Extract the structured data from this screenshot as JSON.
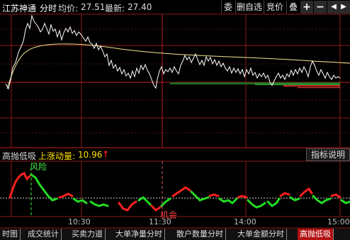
{
  "header": {
    "stock_name": "江苏神通",
    "mode": "分时",
    "avg_label": "均价:",
    "avg_value": "27.51",
    "last_label": "最新:",
    "last_value": "27.40"
  },
  "toolbar": {
    "btn_delegate": "委",
    "btn_remove_fav": "删自选",
    "btn_auction": "竞价",
    "btn_overlay": "叠",
    "btn_plus": "+",
    "btn_minus": "−",
    "btn_left": "◀",
    "btn_right": "▶"
  },
  "indicator": {
    "name": "高抛低吸",
    "momentum_label": "上涨动量:",
    "momentum_value": "10.96",
    "momentum_arrow": "↑",
    "help_button": "指标说明",
    "annotation_risk": "风险",
    "annotation_chance": "机会"
  },
  "xaxis": {
    "ticks": [
      "10:30",
      "11:30",
      "14:00",
      "15:00"
    ]
  },
  "tabs": [
    {
      "label": "时图",
      "active": false
    },
    {
      "label": "成交统计",
      "active": false
    },
    {
      "label": "买卖力道",
      "active": false
    },
    {
      "label": "大单净量分时",
      "active": false
    },
    {
      "label": "散户数量分时",
      "active": false
    },
    {
      "label": "大单金额分时",
      "active": false
    },
    {
      "label": "高抛低吸",
      "active": true
    }
  ],
  "colors": {
    "grid_red": "#8b1a1a",
    "price_line": "#ffffff",
    "avg_line": "#f0e68c",
    "up_red": "#ff2020",
    "down_green": "#22dd22",
    "label_yellow": "#ffe000",
    "label_green": "#44ee44"
  }
}
